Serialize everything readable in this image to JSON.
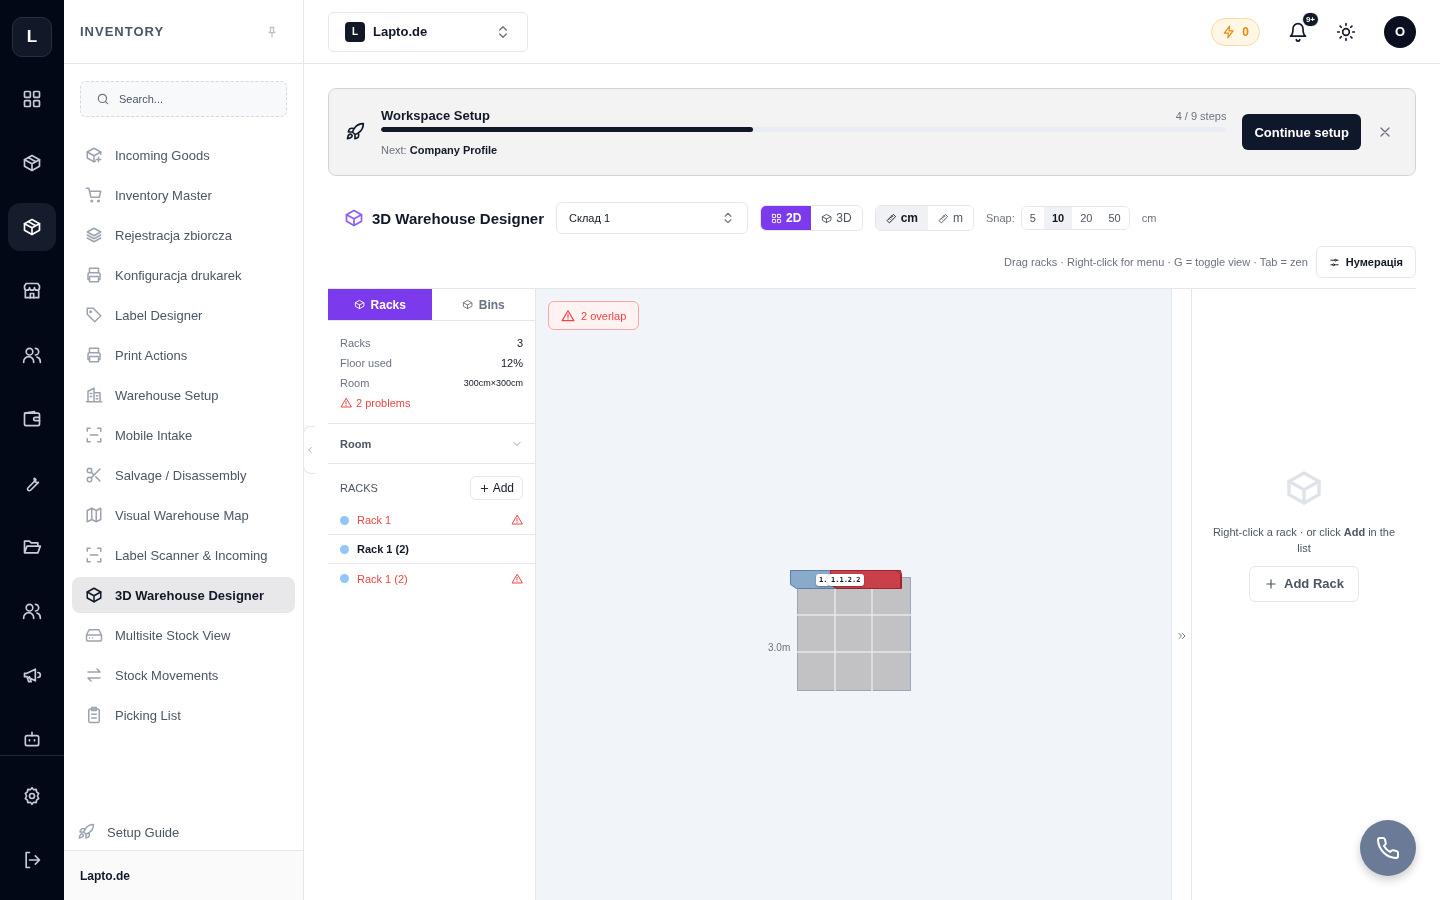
{
  "rail": {
    "logo": "L",
    "items": [
      {
        "selected": false
      },
      {
        "selected": false
      },
      {
        "selected": true
      },
      {
        "selected": false
      },
      {
        "selected": false
      },
      {
        "selected": false
      },
      {
        "selected": false
      },
      {
        "selected": false
      },
      {
        "selected": false
      },
      {
        "selected": false
      },
      {
        "selected": false
      }
    ]
  },
  "sidebar": {
    "title": "INVENTORY",
    "search": {
      "placeholder": "Search..."
    },
    "items": [
      {
        "label": "Incoming Goods",
        "selected": false
      },
      {
        "label": "Inventory Master",
        "selected": false
      },
      {
        "label": "Rejestracja zbiorcza",
        "selected": false
      },
      {
        "label": "Konfiguracja drukarek",
        "selected": false
      },
      {
        "label": "Label Designer",
        "selected": false
      },
      {
        "label": "Print Actions",
        "selected": false
      },
      {
        "label": "Warehouse Setup",
        "selected": false
      },
      {
        "label": "Mobile Intake",
        "selected": false
      },
      {
        "label": "Salvage / Disassembly",
        "selected": false
      },
      {
        "label": "Visual Warehouse Map",
        "selected": false
      },
      {
        "label": "Label Scanner & Incoming",
        "selected": false
      },
      {
        "label": "3D Warehouse Designer",
        "selected": true
      },
      {
        "label": "Multisite Stock View",
        "selected": false
      },
      {
        "label": "Stock Movements",
        "selected": false
      },
      {
        "label": "Picking List",
        "selected": false
      }
    ],
    "setup_guide": "Setup Guide",
    "workspace": "Lapto.de"
  },
  "topbar": {
    "workspace_switcher": {
      "badge": "L",
      "name": "Lapto.de"
    },
    "credits": "0",
    "notifications_badge": "9+",
    "avatar": "O"
  },
  "setup_banner": {
    "title": "Workspace Setup",
    "steps": "4 / 9 steps",
    "level": 0.44,
    "next_label": "Next:",
    "next_value": "Company Profile",
    "button": "Continue setup"
  },
  "designer": {
    "title": "3D Warehouse Designer",
    "warehouse": "Склад 1",
    "views": [
      {
        "label": "2D",
        "selected": true
      },
      {
        "label": "3D",
        "selected": false
      }
    ],
    "units": [
      {
        "label": "cm",
        "selected": true
      },
      {
        "label": "m",
        "selected": false
      }
    ],
    "snap_label": "Snap:",
    "snap": [
      {
        "label": "5",
        "selected": false
      },
      {
        "label": "10",
        "selected": true
      },
      {
        "label": "20",
        "selected": false
      },
      {
        "label": "50",
        "selected": false
      }
    ],
    "snap_unit": "cm",
    "hint": "Drag racks · Right-click for menu · G = toggle view · Tab = zen",
    "numbering_button": "Нумерація"
  },
  "left_panel": {
    "tabs": [
      {
        "label": "Racks",
        "selected": true
      },
      {
        "label": "Bins",
        "selected": false
      }
    ],
    "stats": [
      {
        "label": "Racks",
        "value": "3"
      },
      {
        "label": "Floor used",
        "value": "12%"
      },
      {
        "label": "Room",
        "value": "300cm×300cm"
      }
    ],
    "problems": "2 problems",
    "room_section": "Room",
    "racks_heading": "RACKS",
    "add_button": "Add",
    "racks": [
      {
        "name": "Rack 1",
        "color": "#93c5fd",
        "warning": true
      },
      {
        "name": "Rack 1 (2)",
        "color": "#93c5fd",
        "warning": false
      },
      {
        "name": "Rack 1 (2)",
        "color": "#93c5fd",
        "warning": true
      }
    ]
  },
  "canvas": {
    "overlap_badge": "2 overlap",
    "dimension_label": "3.0m",
    "rack_labels": [
      "1.",
      "1.1.2.2"
    ]
  },
  "right_panel": {
    "hint": "Right-click a rack · or click **Add** in the list",
    "button": "Add Rack"
  }
}
